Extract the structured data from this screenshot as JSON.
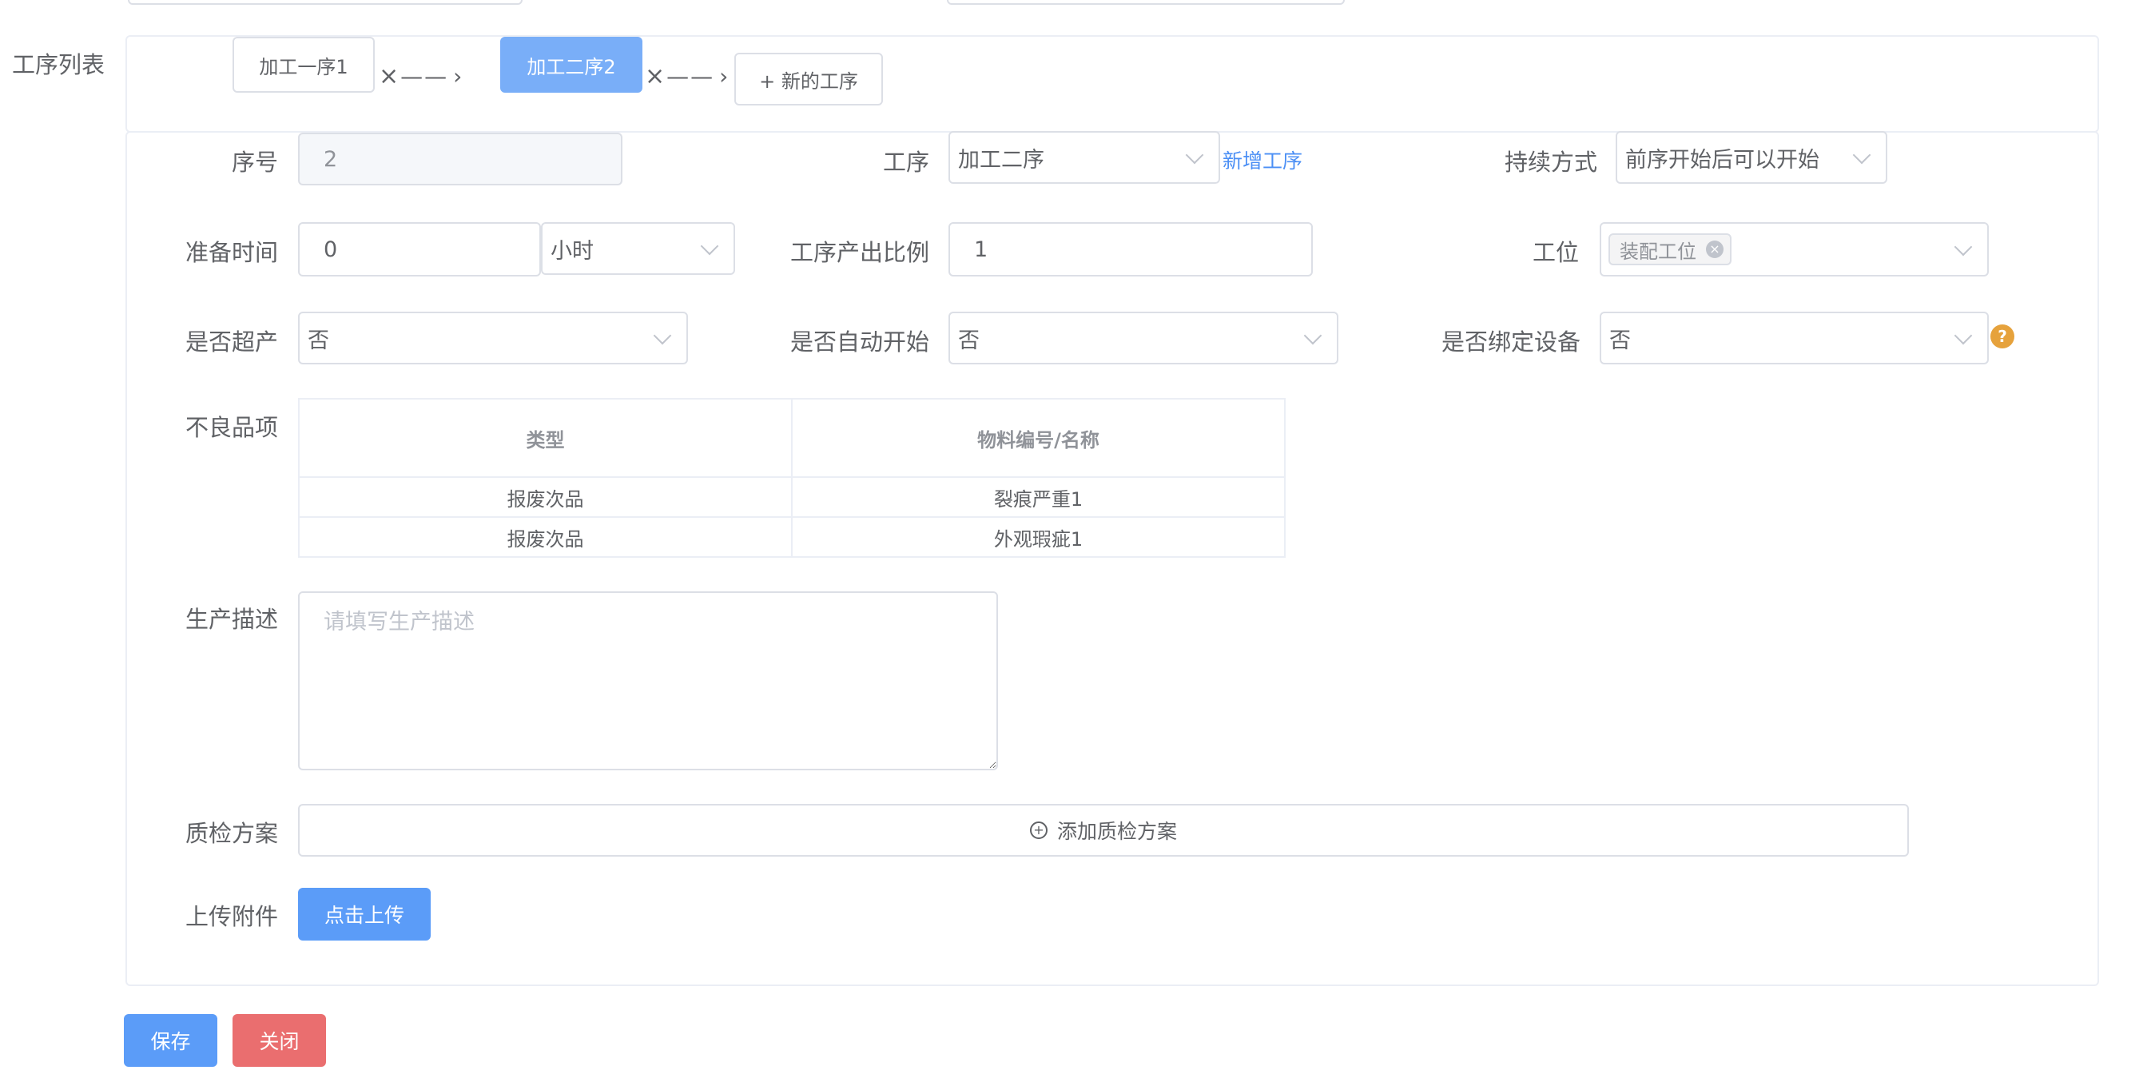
{
  "process_list": {
    "label": "工序列表",
    "items": [
      {
        "name": "加工一序1"
      },
      {
        "name": "加工二序2"
      }
    ],
    "remove_symbol": "×",
    "connector": "——",
    "arrow_symbol": "›",
    "add_label": "+ 新的工序"
  },
  "form": {
    "seq_label": "序号",
    "seq_value": "2",
    "process_label": "工序",
    "process_value": "加工二序",
    "add_process_link": "新增工序",
    "continuation_label": "持续方式",
    "continuation_value": "前序开始后可以开始",
    "prep_time_label": "准备时间",
    "prep_time_value": "0",
    "prep_time_unit": "小时",
    "output_ratio_label": "工序产出比例",
    "output_ratio_value": "1",
    "station_label": "工位",
    "station_tag": "装配工位",
    "overproduce_label": "是否超产",
    "overproduce_value": "否",
    "auto_start_label": "是否自动开始",
    "auto_start_value": "否",
    "bind_device_label": "是否绑定设备",
    "bind_device_value": "否",
    "help_glyph": "?",
    "defects_label": "不良品项",
    "defects_table": {
      "headers": [
        "类型",
        "物料编号/名称"
      ],
      "rows": [
        [
          "报废次品",
          "裂痕严重1"
        ],
        [
          "报废次品",
          "外观瑕疵1"
        ]
      ]
    },
    "description_label": "生产描述",
    "description_placeholder": "请填写生产描述",
    "qc_label": "质检方案",
    "qc_add_label": "添加质检方案",
    "upload_label": "上传附件",
    "upload_button": "点击上传"
  },
  "actions": {
    "save": "保存",
    "close": "关闭"
  },
  "colors": {
    "primary": "#5b9cf8",
    "active_tab": "#79aef8",
    "danger": "#ea6e6f",
    "link": "#4b8ff5",
    "warning": "#e6a23c"
  }
}
